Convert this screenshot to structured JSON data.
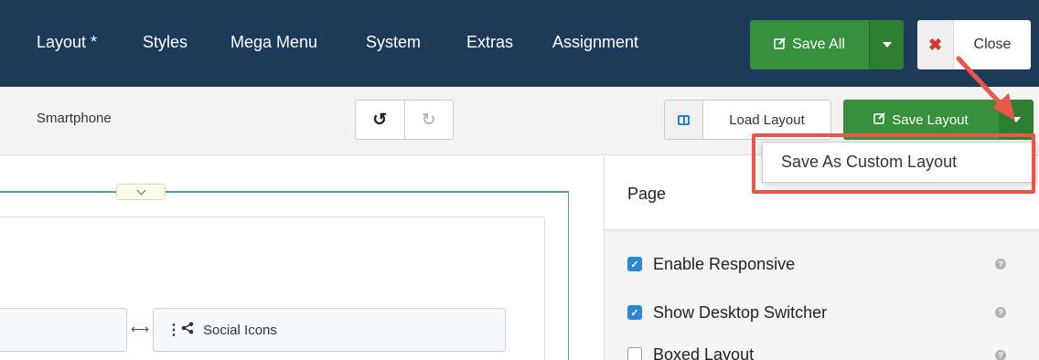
{
  "nav": {
    "items": [
      "Layout *",
      "Styles",
      "Mega Menu",
      "System",
      "Extras",
      "Assignment"
    ],
    "save_all": "Save All",
    "close": "Close"
  },
  "toolbar": {
    "device": "Smartphone",
    "load_layout": "Load Layout",
    "save_layout": "Save Layout"
  },
  "dropdown": {
    "item": "Save As Custom Layout"
  },
  "canvas": {
    "block_label": "Social Icons"
  },
  "side": {
    "title": "Page",
    "options": [
      {
        "label": "Enable Responsive",
        "checked": true
      },
      {
        "label": "Show Desktop Switcher",
        "checked": true
      },
      {
        "label": "Boxed Layout",
        "checked": false
      }
    ]
  },
  "colors": {
    "navbar": "#1d3a58",
    "success": "#37903b",
    "danger": "#d9332a",
    "highlight": "#e8574a",
    "checkbox": "#2a86d6"
  }
}
